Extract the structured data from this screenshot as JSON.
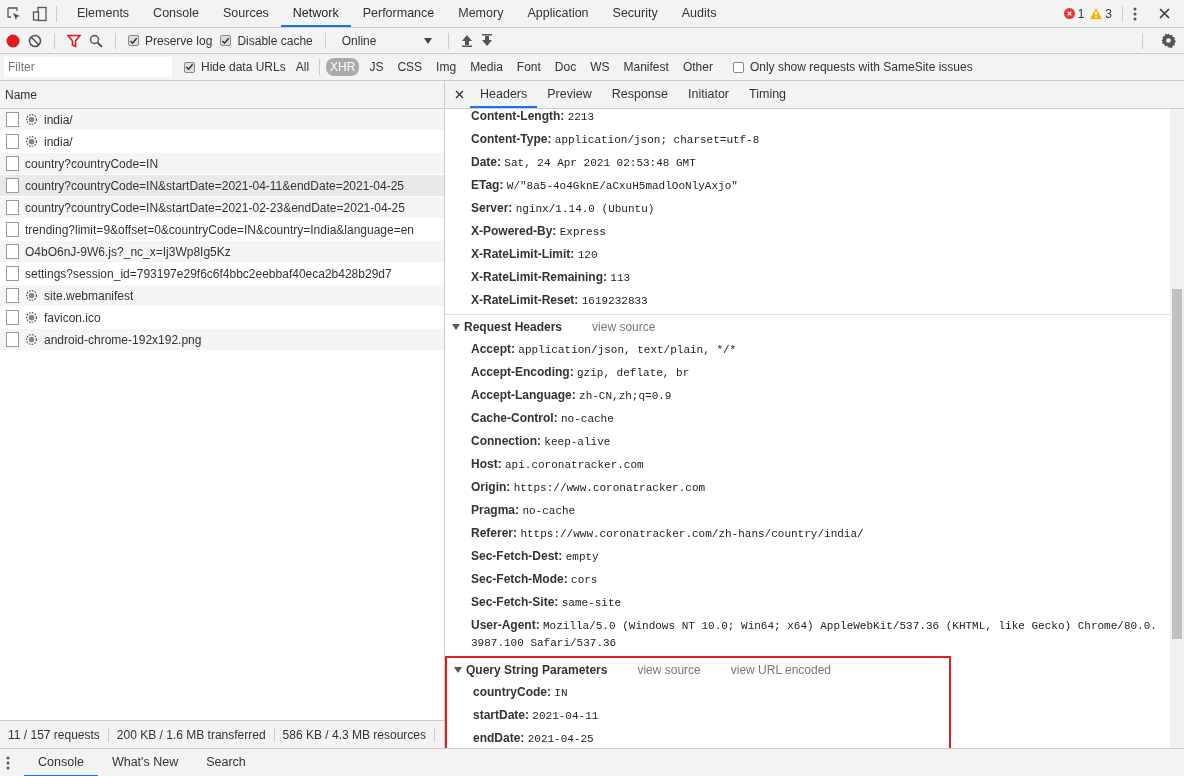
{
  "top_tabs": [
    {
      "label": "Elements",
      "selected": false
    },
    {
      "label": "Console",
      "selected": false
    },
    {
      "label": "Sources",
      "selected": false
    },
    {
      "label": "Network",
      "selected": true
    },
    {
      "label": "Performance",
      "selected": false
    },
    {
      "label": "Memory",
      "selected": false
    },
    {
      "label": "Application",
      "selected": false
    },
    {
      "label": "Security",
      "selected": false
    },
    {
      "label": "Audits",
      "selected": false
    }
  ],
  "issues": {
    "errors": "1",
    "warnings": "3"
  },
  "toolbar": {
    "recording": true,
    "filter_active": true,
    "checkboxes": [
      {
        "label": "Preserve log",
        "checked": true
      },
      {
        "label": "Disable cache",
        "checked": true
      }
    ],
    "throttling": "Online"
  },
  "filter_bar": {
    "placeholder": "Filter",
    "hide_data_urls": {
      "label": "Hide data URLs",
      "checked": true
    },
    "types": [
      {
        "label": "All",
        "selected": false
      },
      {
        "label": "XHR",
        "selected": true
      },
      {
        "label": "JS",
        "selected": false
      },
      {
        "label": "CSS",
        "selected": false
      },
      {
        "label": "Img",
        "selected": false
      },
      {
        "label": "Media",
        "selected": false
      },
      {
        "label": "Font",
        "selected": false
      },
      {
        "label": "Doc",
        "selected": false
      },
      {
        "label": "WS",
        "selected": false
      },
      {
        "label": "Manifest",
        "selected": false
      },
      {
        "label": "Other",
        "selected": false
      }
    ],
    "samesite": {
      "label": "Only show requests with SameSite issues",
      "checked": false
    }
  },
  "requests": {
    "column": "Name",
    "rows": [
      {
        "name": "india/",
        "kind": "resource",
        "selected": false
      },
      {
        "name": "india/",
        "kind": "resource",
        "selected": false
      },
      {
        "name": "country?countryCode=IN",
        "kind": "plain",
        "selected": false
      },
      {
        "name": "country?countryCode=IN&startDate=2021-04-11&endDate=2021-04-25",
        "kind": "plain",
        "selected": true
      },
      {
        "name": "country?countryCode=IN&startDate=2021-02-23&endDate=2021-04-25",
        "kind": "plain",
        "selected": false
      },
      {
        "name": "trending?limit=9&offset=0&countryCode=IN&country=India&language=en",
        "kind": "plain",
        "selected": false
      },
      {
        "name": "O4bO6nJ-9W6.js?_nc_x=Ij3Wp8Ig5Kz",
        "kind": "plain",
        "selected": false
      },
      {
        "name": "settings?session_id=793197e29f6c6f4bbc2eebbaf40eca2b428b29d7",
        "kind": "plain",
        "selected": false
      },
      {
        "name": "site.webmanifest",
        "kind": "resource",
        "selected": false
      },
      {
        "name": "favicon.ico",
        "kind": "resource",
        "selected": false
      },
      {
        "name": "android-chrome-192x192.png",
        "kind": "resource",
        "selected": false
      }
    ]
  },
  "status_bar": [
    "11 / 157 requests",
    "200 KB / 1.6 MB transferred",
    "586 KB / 4.3 MB resources"
  ],
  "detail": {
    "tabs": [
      {
        "label": "Headers",
        "selected": true
      },
      {
        "label": "Preview",
        "selected": false
      },
      {
        "label": "Response",
        "selected": false
      },
      {
        "label": "Initiator",
        "selected": false
      },
      {
        "label": "Timing",
        "selected": false
      }
    ],
    "response_headers": [
      {
        "name": "Content-Length:",
        "value": "2213"
      },
      {
        "name": "Content-Type:",
        "value": "application/json; charset=utf-8"
      },
      {
        "name": "Date:",
        "value": "Sat, 24 Apr 2021 02:53:48 GMT"
      },
      {
        "name": "ETag:",
        "value": "W/\"8a5-4o4GknE/aCxuH5madlOoNlyAxjo\""
      },
      {
        "name": "Server:",
        "value": "nginx/1.14.0 (Ubuntu)"
      },
      {
        "name": "X-Powered-By:",
        "value": "Express"
      },
      {
        "name": "X-RateLimit-Limit:",
        "value": "120"
      },
      {
        "name": "X-RateLimit-Remaining:",
        "value": "113"
      },
      {
        "name": "X-RateLimit-Reset:",
        "value": "1619232833"
      }
    ],
    "sections": [
      {
        "title": "Request Headers",
        "expanded": true,
        "highlighted": false,
        "links": [
          "view source"
        ],
        "headers": [
          {
            "name": "Accept:",
            "value": "application/json, text/plain, */*"
          },
          {
            "name": "Accept-Encoding:",
            "value": "gzip, deflate, br"
          },
          {
            "name": "Accept-Language:",
            "value": "zh-CN,zh;q=0.9"
          },
          {
            "name": "Cache-Control:",
            "value": "no-cache"
          },
          {
            "name": "Connection:",
            "value": "keep-alive"
          },
          {
            "name": "Host:",
            "value": "api.coronatracker.com"
          },
          {
            "name": "Origin:",
            "value": "https://www.coronatracker.com"
          },
          {
            "name": "Pragma:",
            "value": "no-cache"
          },
          {
            "name": "Referer:",
            "value": "https://www.coronatracker.com/zh-hans/country/india/"
          },
          {
            "name": "Sec-Fetch-Dest:",
            "value": "empty"
          },
          {
            "name": "Sec-Fetch-Mode:",
            "value": "cors"
          },
          {
            "name": "Sec-Fetch-Site:",
            "value": "same-site"
          },
          {
            "name": "User-Agent:",
            "value": "Mozilla/5.0 (Windows NT 10.0; Win64; x64) AppleWebKit/537.36 (KHTML, like Gecko) Chrome/80.0.3987.100 Safari/537.36"
          }
        ]
      },
      {
        "title": "Query String Parameters",
        "expanded": true,
        "highlighted": true,
        "links": [
          "view source",
          "view URL encoded"
        ],
        "headers": [
          {
            "name": "countryCode:",
            "value": "IN"
          },
          {
            "name": "startDate:",
            "value": "2021-04-11"
          },
          {
            "name": "endDate:",
            "value": "2021-04-25"
          }
        ]
      }
    ]
  },
  "drawer_tabs": [
    {
      "label": "Console",
      "selected": true
    },
    {
      "label": "What's New",
      "selected": false
    },
    {
      "label": "Search",
      "selected": false
    }
  ]
}
